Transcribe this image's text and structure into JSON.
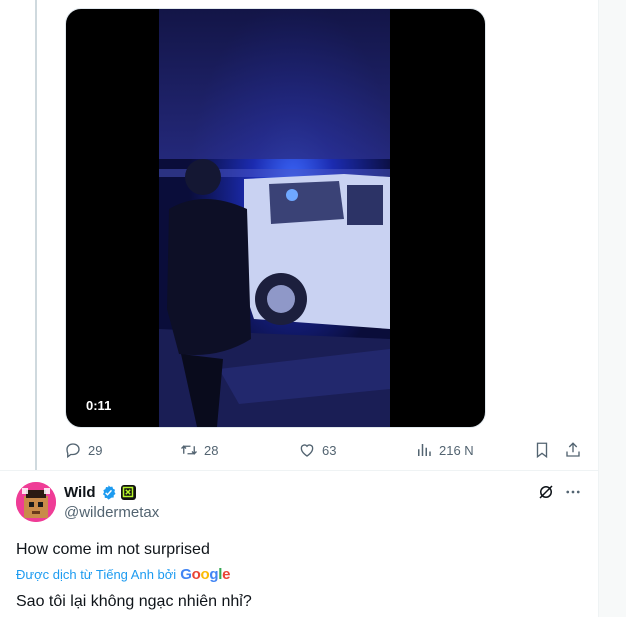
{
  "video": {
    "duration": "0:11"
  },
  "actions": {
    "replies": "29",
    "reposts": "28",
    "likes": "63",
    "views": "216 N"
  },
  "reply": {
    "name": "Wild",
    "handle": "@wildermetax",
    "text": "How come im not surprised",
    "translated_by": "Được dịch từ Tiếng Anh bởi",
    "translation_provider": "Google",
    "translated_text": "Sao tôi lại không ngạc nhiên nhỉ?"
  },
  "colors": {
    "accent": "#1d9bf0",
    "secondary_text": "#536471",
    "avatar_bg": "#ef3c96"
  },
  "icons": [
    "reply-icon",
    "repost-icon",
    "like-icon",
    "views-icon",
    "bookmark-icon",
    "share-icon",
    "verified-badge-icon",
    "affiliate-badge-icon",
    "grok-icon",
    "more-icon"
  ]
}
